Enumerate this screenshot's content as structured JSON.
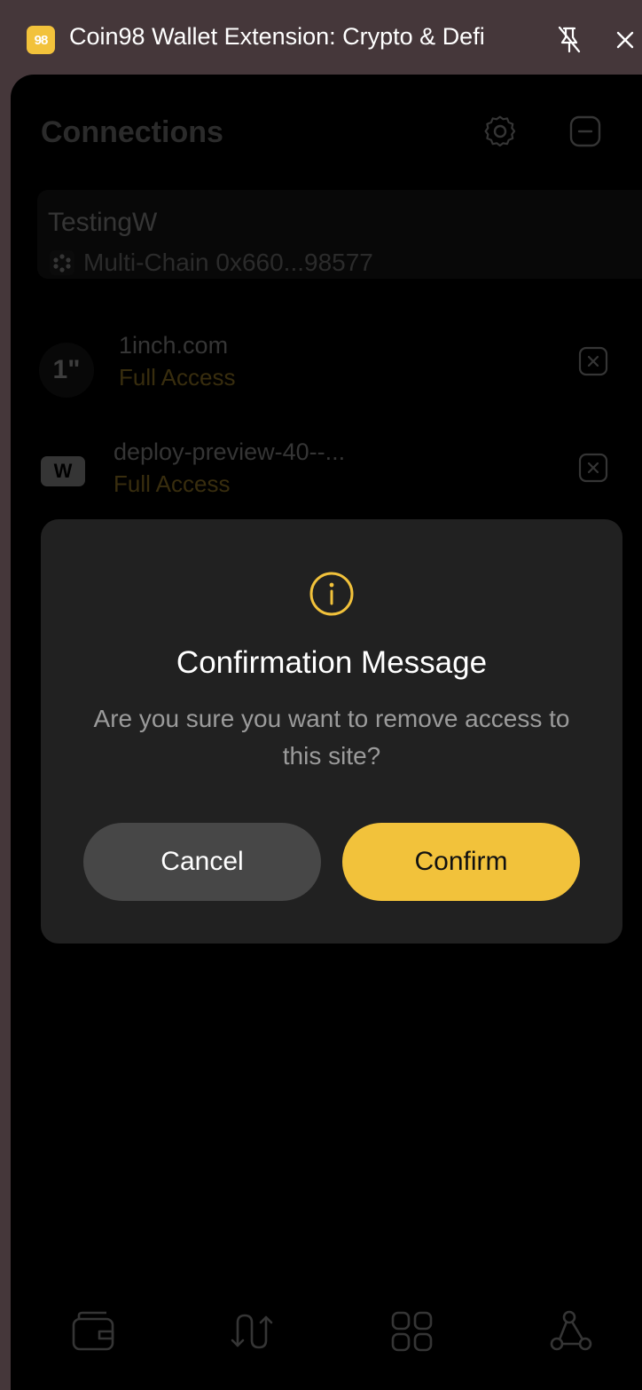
{
  "window": {
    "logo_text": "98",
    "title": "Coin98 Wallet Extension: Crypto & Defi"
  },
  "connections": {
    "title": "Connections",
    "wallet": {
      "name": "TestingW",
      "chain": "Multi-Chain 0x660...98577"
    },
    "sites": [
      {
        "logo_text": "1\"",
        "name": "1inch.com",
        "access": "Full Access"
      },
      {
        "logo_text": "W",
        "name": "deploy-preview-40--...",
        "access": "Full Access"
      }
    ]
  },
  "modal": {
    "title": "Confirmation Message",
    "message": "Are you sure you want to remove access to this site?",
    "cancel_label": "Cancel",
    "confirm_label": "Confirm"
  },
  "colors": {
    "accent": "#f2c23b",
    "background": "#000000",
    "modal_bg": "#212121",
    "cancel_bg": "#474747"
  }
}
